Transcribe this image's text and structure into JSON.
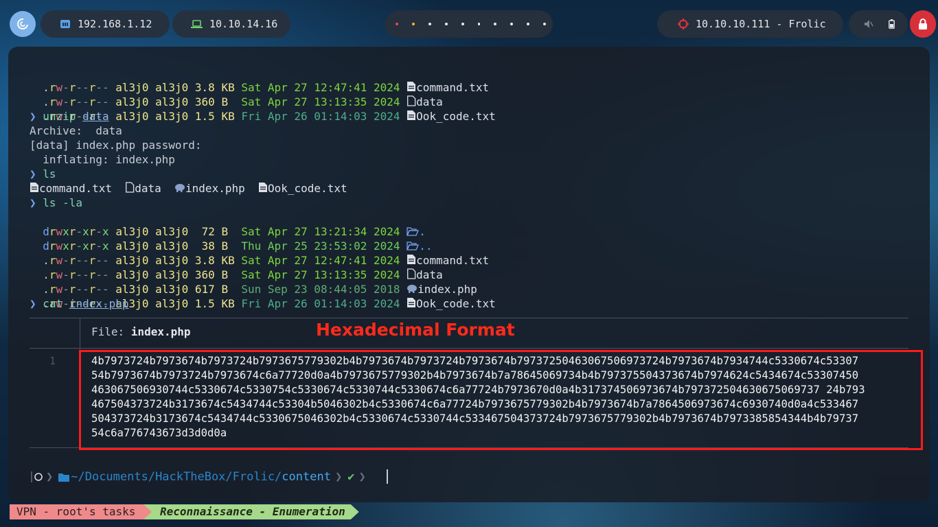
{
  "topbar": {
    "ip_local": "192.168.1.12",
    "ip_vpn": "10.10.14.16",
    "target": "10.10.10.111 - Frolic",
    "workspace_count": 10
  },
  "terminal": {
    "rows_top": [
      {
        "perm": ".rw-r--r--",
        "user": "al3j0",
        "group": "al3j0",
        "size": "3.8 KB",
        "date": "Sat Apr 27 12:47:41 2024",
        "name": "command.txt"
      },
      {
        "perm": ".rw-r--r--",
        "user": "al3j0",
        "group": "al3j0",
        "size": "360 B ",
        "date": "Sat Apr 27 13:13:35 2024",
        "name": "data"
      },
      {
        "perm": ".rw-r--r--",
        "user": "al3j0",
        "group": "al3j0",
        "size": "1.5 KB",
        "date": "Fri Apr 26 01:14:03 2024",
        "name": "Ook_code.txt"
      }
    ],
    "cmd_unzip": "unzip",
    "cmd_unzip_arg": "data",
    "unzip_out_1": "Archive:  data",
    "unzip_out_2": "[data] index.php password:",
    "unzip_out_3": "  inflating: index.php",
    "cmd_ls": "ls",
    "ls_items": [
      "command.txt",
      "data",
      "index.php",
      "Ook_code.txt"
    ],
    "cmd_ls_la": "ls -la",
    "rows_la": [
      {
        "perm": "drwxr-xr-x",
        "user": "al3j0",
        "group": "al3j0",
        "size": " 72 B ",
        "date": "Sat Apr 27 13:21:34 2024",
        "name": "."
      },
      {
        "perm": "drwxr-xr-x",
        "user": "al3j0",
        "group": "al3j0",
        "size": " 38 B ",
        "date": "Thu Apr 25 23:53:02 2024",
        "name": ".."
      },
      {
        "perm": ".rw-r--r--",
        "user": "al3j0",
        "group": "al3j0",
        "size": "3.8 KB",
        "date": "Sat Apr 27 12:47:41 2024",
        "name": "command.txt"
      },
      {
        "perm": ".rw-r--r--",
        "user": "al3j0",
        "group": "al3j0",
        "size": "360 B ",
        "date": "Sat Apr 27 13:13:35 2024",
        "name": "data"
      },
      {
        "perm": ".rw-r--r--",
        "user": "al3j0",
        "group": "al3j0",
        "size": "617 B ",
        "date": "Sun Sep 23 08:44:05 2018",
        "name": "index.php"
      },
      {
        "perm": ".rw-r--r--",
        "user": "al3j0",
        "group": "al3j0",
        "size": "1.5 KB",
        "date": "Fri Apr 26 01:14:03 2024",
        "name": "Ook_code.txt"
      }
    ],
    "cmd_cat": "cat",
    "cmd_cat_arg": "index.php",
    "file_label": "File: ",
    "file_name": "index.php",
    "line_number": "1",
    "annotation": "Hexadecimal Format",
    "hex_lines": [
      "4b7973724b7973674b7973724b7973675779302b4b7973674b7973724b7973674b79737250463067506973724b7973674b7934744c5330674c53307",
      "54b7973674b7973724b7973674c6a77720d0a4b7973675779302b4b7973674b7a78645069734b4b797375504373674b7974624c5434674c53307450",
      "463067506930744c5330674c5330754c5330674c5330744c5330674c6a77724b7973670d0a4b317374506973674b797372504630675069737 24b793",
      "467504373724b3173674c5434744c53304b5046302b4c5330674c6a77724b7973675779302b4b7973674b7a7864506973674c6930740d0a4c533467",
      "504373724b3173674c5434744c5330675046302b4c5330674c5330744c533467504373724b7973675779302b4b7973674b7973385854344b4b79737",
      "54c6a776743673d3d0d0a"
    ],
    "prompt_path": "~/Documents/HackTheBox/Frolic/",
    "prompt_dir": "content"
  },
  "statusbar": {
    "session": "VPN - root's tasks",
    "window": "Reconnaissance - Enumeration"
  },
  "colors": {
    "annotation": "#ff2a1a",
    "power": "#d7303b"
  }
}
